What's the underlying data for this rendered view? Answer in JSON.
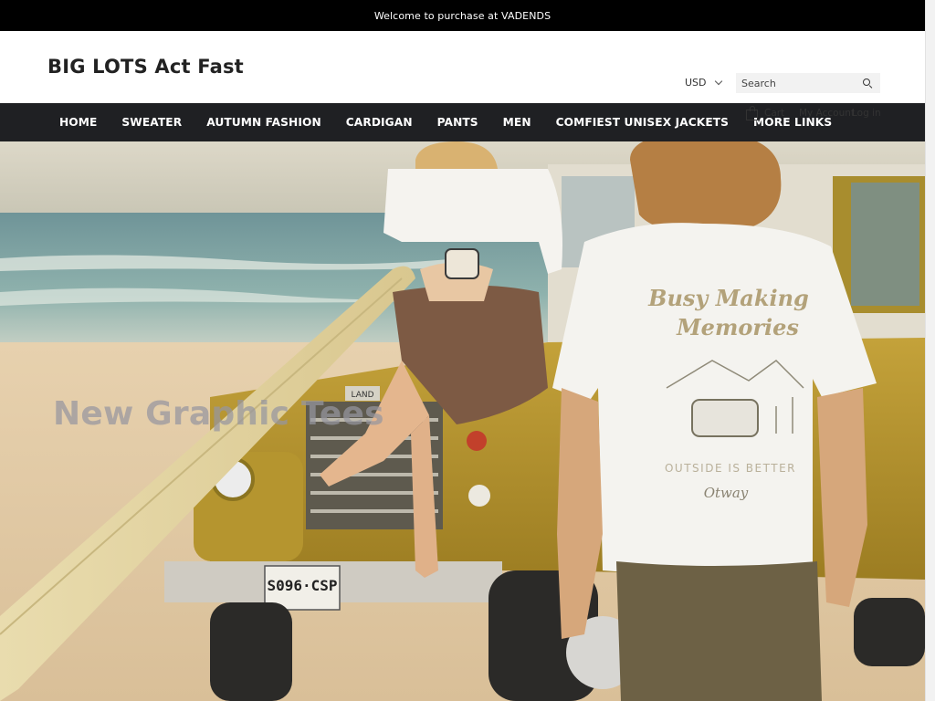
{
  "announcement": "Welcome to purchase at VADENDS",
  "header": {
    "logo": "BIG LOTS Act Fast",
    "currency": "USD",
    "search_placeholder": "Search",
    "cart": "Cart",
    "my_account": "My Account",
    "log_in": "Log in"
  },
  "nav": [
    "HOME",
    "SWEATER",
    "AUTUMN FASHION",
    "CARDIGAN",
    "PANTS",
    "MEN",
    "COMFIEST UNISEX JACKETS",
    "MORE LINKS"
  ],
  "hero": {
    "heading": "New Graphic Tees",
    "shirt_print_line1": "Busy Making",
    "shirt_print_line2": "Memories",
    "shirt_print_tagline": "OUTSIDE IS BETTER",
    "shirt_print_brand": "Otway",
    "license_plate": "S096·CSP",
    "grille_badge": "LAND"
  },
  "colors": {
    "announcement_bg": "#000000",
    "nav_bg": "#1f2023",
    "truck_yellow": "#b8962c",
    "sand": "#e2c9a4",
    "sea": "#7da2a6"
  }
}
